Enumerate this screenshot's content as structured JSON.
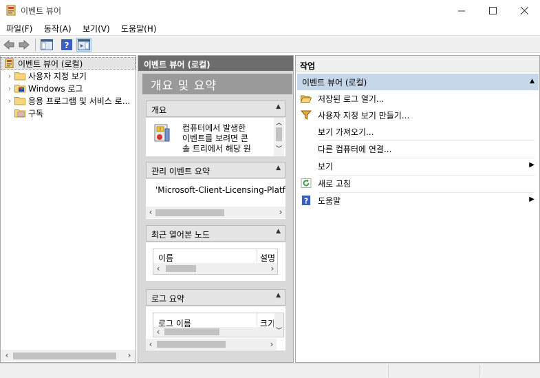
{
  "window": {
    "title": "이벤트 뷰어"
  },
  "menu": {
    "items": [
      "파일(F)",
      "동작(A)",
      "보기(V)",
      "도움말(H)"
    ]
  },
  "tree": {
    "root": "이벤트 뷰어 (로컬)",
    "items": [
      {
        "label": "사용자 지정 보기",
        "icon": "folder-icon"
      },
      {
        "label": "Windows 로그",
        "icon": "windows-logs-icon"
      },
      {
        "label": "응용 프로그램 및 서비스 로...",
        "icon": "folder-icon"
      },
      {
        "label": "구독",
        "icon": "subscriptions-icon"
      }
    ]
  },
  "middle": {
    "header": "이벤트 뷰어 (로컬)",
    "banner": "개요 및 요약",
    "overview": {
      "title": "개요",
      "lines": [
        "컴퓨터에서 발생한",
        "이벤트를 보려면 콘",
        "솔 트리에서 해당 원"
      ]
    },
    "admin": {
      "title": "관리 이벤트 요약",
      "row": "'Microsoft-Client-Licensing-Platform"
    },
    "recent": {
      "title": "최근 열어본 노드",
      "col1": "이름",
      "col2": "설명"
    },
    "logs": {
      "title": "로그 요약",
      "col1": "로그 이름",
      "col2": "크기"
    }
  },
  "actions": {
    "header": "작업",
    "section": "이벤트 뷰어 (로컬)",
    "items": [
      {
        "label": "저장된 로그 열기...",
        "icon": "open-folder-icon"
      },
      {
        "label": "사용자 지정 보기 만들기...",
        "icon": "filter-icon"
      },
      {
        "label": "보기 가져오기...",
        "icon": ""
      },
      {
        "label": "다른 컴퓨터에 연결...",
        "icon": ""
      },
      {
        "label": "보기",
        "icon": ""
      },
      {
        "label": "새로 고침",
        "icon": "refresh-icon"
      },
      {
        "label": "도움말",
        "icon": "help-icon"
      }
    ]
  },
  "colors": {
    "accent": "#c7d7ea",
    "mid_header": "#6d6d6d",
    "banner": "#9a9a9a"
  }
}
